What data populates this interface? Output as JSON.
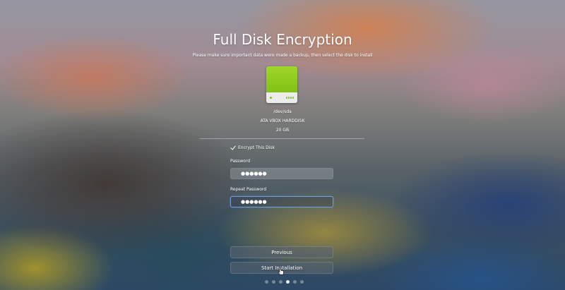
{
  "page": {
    "title": "Full Disk Encryption",
    "subtitle": "Please make sure important data were made a backup, then select the disk to install"
  },
  "disk": {
    "icon": "hard-disk-icon",
    "path": "/dev/sda",
    "model": "ATA VBOX HARDDISK",
    "size": "20 GB",
    "color": "#8fcb1c"
  },
  "encryption": {
    "checkbox_label": "Encrypt This Disk",
    "checked": true
  },
  "password": {
    "label": "Password",
    "value": "●●●●●●"
  },
  "repeat_password": {
    "label": "Repeat Password",
    "value": "●●●●●●"
  },
  "buttons": {
    "previous": "Previous",
    "start": "Start Installation"
  },
  "pager": {
    "total": 6,
    "current": 4
  },
  "colors": {
    "focus_border": "#78aaf0"
  }
}
